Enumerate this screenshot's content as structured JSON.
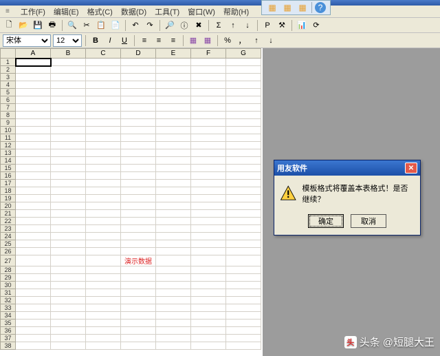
{
  "menu": {
    "prefix": "≡",
    "items": [
      "工作(F)",
      "编辑(E)",
      "格式(C)",
      "数据(D)",
      "工具(T)",
      "窗口(W)",
      "帮助(H)"
    ]
  },
  "top_strip": {
    "icons": [
      "layout-icon",
      "layout-icon",
      "layout-icon",
      "help-icon"
    ],
    "glyphs": [
      "▦",
      "▦",
      "▦",
      "?"
    ]
  },
  "toolbar1": {
    "icons": [
      "new-icon",
      "open-icon",
      "save-icon",
      "print-icon",
      "preview-icon",
      "cut-icon",
      "copy-icon",
      "paste-icon",
      "undo-icon",
      "redo-icon",
      "find-icon",
      "insert-icon",
      "delete-icon",
      "sum-icon",
      "sort-asc-icon",
      "sort-desc-icon",
      "bold-p-icon",
      "tools-icon",
      "chart-icon",
      "refresh-icon"
    ],
    "glyphs": [
      "🗋",
      "📂",
      "💾",
      "🖶",
      "🔍",
      "✂",
      "📋",
      "📄",
      "↶",
      "↷",
      "🔎",
      "ⓘ",
      "✖",
      "Σ",
      "↑",
      "↓",
      "P",
      "⚒",
      "📊",
      "⟳"
    ]
  },
  "toolbar2": {
    "font_name": "宋体",
    "font_size": "12",
    "icons": [
      "bold-icon",
      "italic-icon",
      "underline-icon",
      "align-left-icon",
      "align-center-icon",
      "align-right-icon",
      "fill-icon",
      "fill2-icon",
      "percent-icon",
      "comma-icon",
      "decimal-inc-icon",
      "decimal-dec-icon"
    ],
    "glyphs": [
      "B",
      "I",
      "U",
      "≡",
      "≡",
      "≡",
      "▦",
      "▦",
      "%",
      "，",
      "↑",
      "↓"
    ]
  },
  "sheet": {
    "columns": [
      "A",
      "B",
      "C",
      "D",
      "E",
      "F",
      "G"
    ],
    "rows": 38,
    "selected": {
      "row": 1,
      "col": 0
    },
    "demo_label": "演示数据",
    "demo_pos": {
      "row": 27,
      "col": 3
    }
  },
  "dialog": {
    "title": "用友软件",
    "message": "模板格式将覆盖本表格式！是否继续？",
    "ok": "确定",
    "cancel": "取消"
  },
  "watermark": {
    "prefix": "头条",
    "handle": "@短腿大王"
  },
  "colors": {
    "menu_bg": "#ece9d8",
    "title_blue": "#2d5aa8",
    "warn_yellow": "#ffd040"
  }
}
